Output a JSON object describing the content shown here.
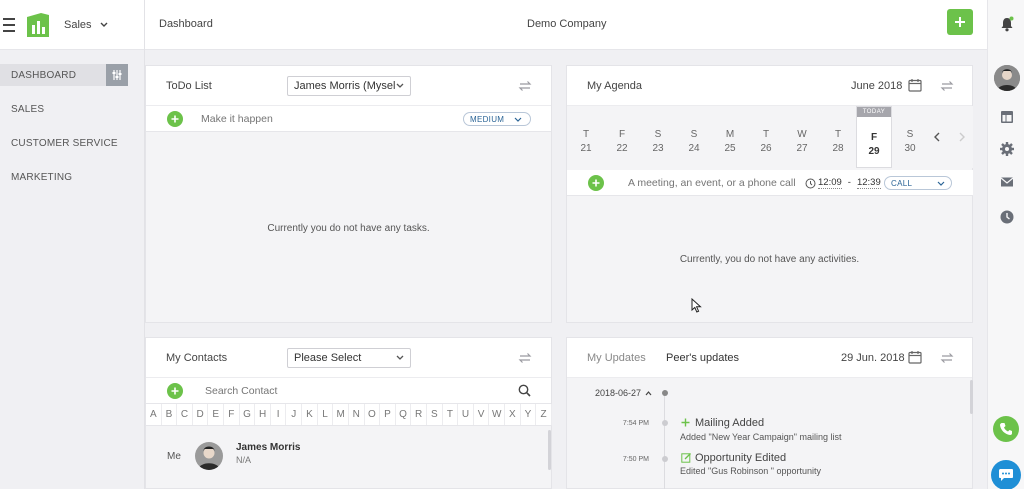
{
  "sidebar": {
    "app_name": "Sales",
    "items": [
      {
        "label": "DASHBOARD"
      },
      {
        "label": "SALES"
      },
      {
        "label": "CUSTOMER SERVICE"
      },
      {
        "label": "MARKETING"
      }
    ]
  },
  "topbar": {
    "title": "Dashboard",
    "company": "Demo Company"
  },
  "todo": {
    "title": "ToDo List",
    "owner_select": "James Morris (Mysel",
    "input_placeholder": "Make it happen",
    "priority": "MEDIUM",
    "empty_text": "Currently you do not have any tasks."
  },
  "agenda": {
    "title": "My Agenda",
    "month": "June 2018",
    "today_tag": "TODAY",
    "days": [
      {
        "dow": "T",
        "num": "21"
      },
      {
        "dow": "F",
        "num": "22"
      },
      {
        "dow": "S",
        "num": "23"
      },
      {
        "dow": "S",
        "num": "24"
      },
      {
        "dow": "M",
        "num": "25"
      },
      {
        "dow": "T",
        "num": "26"
      },
      {
        "dow": "W",
        "num": "27"
      },
      {
        "dow": "T",
        "num": "28"
      },
      {
        "dow": "F",
        "num": "29"
      },
      {
        "dow": "S",
        "num": "30"
      }
    ],
    "input_placeholder": "A meeting, an event, or a phone call",
    "time_start": "12:09",
    "time_sep": "-",
    "time_end": "12:39",
    "type": "CALL",
    "empty_text": "Currently, you do not have any activities."
  },
  "contacts": {
    "title": "My Contacts",
    "select": "Please Select",
    "search_placeholder": "Search Contact",
    "letters": [
      "A",
      "B",
      "C",
      "D",
      "E",
      "F",
      "G",
      "H",
      "I",
      "J",
      "K",
      "L",
      "M",
      "N",
      "O",
      "P",
      "Q",
      "R",
      "S",
      "T",
      "U",
      "V",
      "W",
      "X",
      "Y",
      "Z"
    ],
    "rows": [
      {
        "group": "Me",
        "name": "James Morris",
        "detail": "N/A"
      }
    ]
  },
  "updates": {
    "tab_mine": "My Updates",
    "tab_peers": "Peer's updates",
    "date": "29 Jun. 2018",
    "group_date": "2018-06-27",
    "items": [
      {
        "time": "7:54 PM",
        "title": "Mailing Added",
        "detail": "Added \"New Year Campaign\" mailing list"
      },
      {
        "time": "7:50 PM",
        "title": "Opportunity Edited",
        "detail": "Edited \"Gus Robinson \" opportunity"
      }
    ]
  },
  "colors": {
    "accent_green": "#6cc24a",
    "chat_blue": "#1f8fd6"
  }
}
